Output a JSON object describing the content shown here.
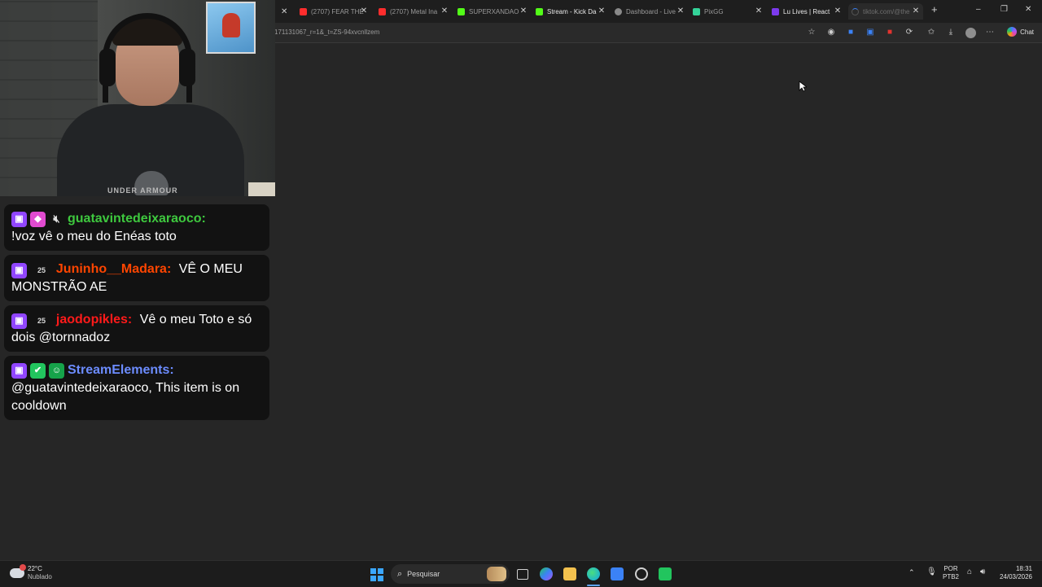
{
  "browser": {
    "tabs": [
      {
        "label": "(2707) FEAR THE",
        "favicon_color": "#ff2d2d"
      },
      {
        "label": "(2707) Metal Ina",
        "favicon_color": "#ff2d2d"
      },
      {
        "label": "SUPERXANDAO",
        "favicon_color": "#53fc18"
      },
      {
        "label": "Stream - Kick Da",
        "favicon_color": "#53fc18"
      },
      {
        "label": "Dashboard - Live",
        "favicon_color": "#8a8a8a"
      },
      {
        "label": "PixGG",
        "favicon_color": "#34d399"
      },
      {
        "label": "Lu Lives | React",
        "favicon_color": "#7c3aed"
      },
      {
        "label": "tiktok.com/@the",
        "favicon_color": "#555555"
      }
    ],
    "url": "171131067_r=1&_t=ZS-94xvcnllzem",
    "copilot_label": "Chat",
    "icons": [
      "favorite-star-icon",
      "extension-icon",
      "shield-icon",
      "translate-icon",
      "office-icon",
      "refresh-icon",
      "favorites-icon",
      "download-icon",
      "profile-icon",
      "more-icon"
    ]
  },
  "webcam": {
    "shirt_text": "UNDER ARMOUR"
  },
  "chat": {
    "messages": [
      {
        "username": "guatavintedeixaraoco:",
        "color": "#3ec83e",
        "text": "!voz vê o meu do Enéas toto",
        "badges": [
          "twitch",
          "gem",
          "mute"
        ]
      },
      {
        "username": "Juninho__Madara:",
        "color": "#ff4500",
        "text": "VÊ O MEU MONSTRÃO AE",
        "badges": [
          "twitch",
          "sub"
        ]
      },
      {
        "username": "jaodopikles:",
        "color": "#ff1a1a",
        "text": "Vê o meu Toto e só dois @tornnadoz",
        "badges": [
          "twitch",
          "sub"
        ]
      },
      {
        "username": "StreamElements:",
        "color": "#6c8cff",
        "text": "@guatavintedeixaraoco, This item is on cooldown",
        "badges": [
          "twitch",
          "green",
          "bot"
        ]
      }
    ],
    "sub_badge_text": "25"
  },
  "taskbar": {
    "weather_temp": "22°C",
    "weather_desc": "Nublado",
    "search_placeholder": "Pesquisar",
    "lang_top": "POR",
    "lang_bottom": "PTB2",
    "time": "18:31",
    "date": "24/03/2026"
  }
}
